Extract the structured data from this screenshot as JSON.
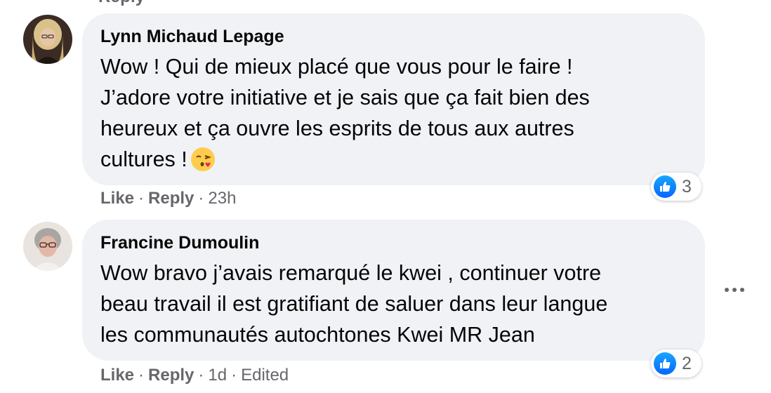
{
  "top_fragment": "Reply",
  "comments": [
    {
      "author": "Lynn Michaud Lepage",
      "text": "Wow ! Qui de mieux placé que vous pour le faire !\nJ’adore votre initiative et je sais que ça fait bien des\nheureux et ça ouvre les esprits de tous aux autres\ncultures !",
      "emoji_icon": "face-blowing-kiss-icon",
      "actions": {
        "like": "Like",
        "reply": "Reply",
        "time": "23h"
      },
      "reaction": {
        "icon": "like-icon",
        "count": "3"
      },
      "avatar_icon": "profile-photo-woman-blonde"
    },
    {
      "author": "Francine Dumoulin",
      "text": "Wow bravo j’avais remarqué le kwei , continuer votre\nbeau travail il est gratifiant de saluer dans leur langue\nles communautés autochtones Kwei MR Jean",
      "actions": {
        "like": "Like",
        "reply": "Reply",
        "time": "1d",
        "edited": "Edited"
      },
      "reaction": {
        "icon": "like-icon",
        "count": "2"
      },
      "avatar_icon": "profile-photo-woman-glasses"
    }
  ],
  "more_options_icon": "more-options-icon",
  "colors": {
    "bubble": "#f0f2f5",
    "meta_text": "#65676b",
    "like_blue": "#0866ff"
  }
}
